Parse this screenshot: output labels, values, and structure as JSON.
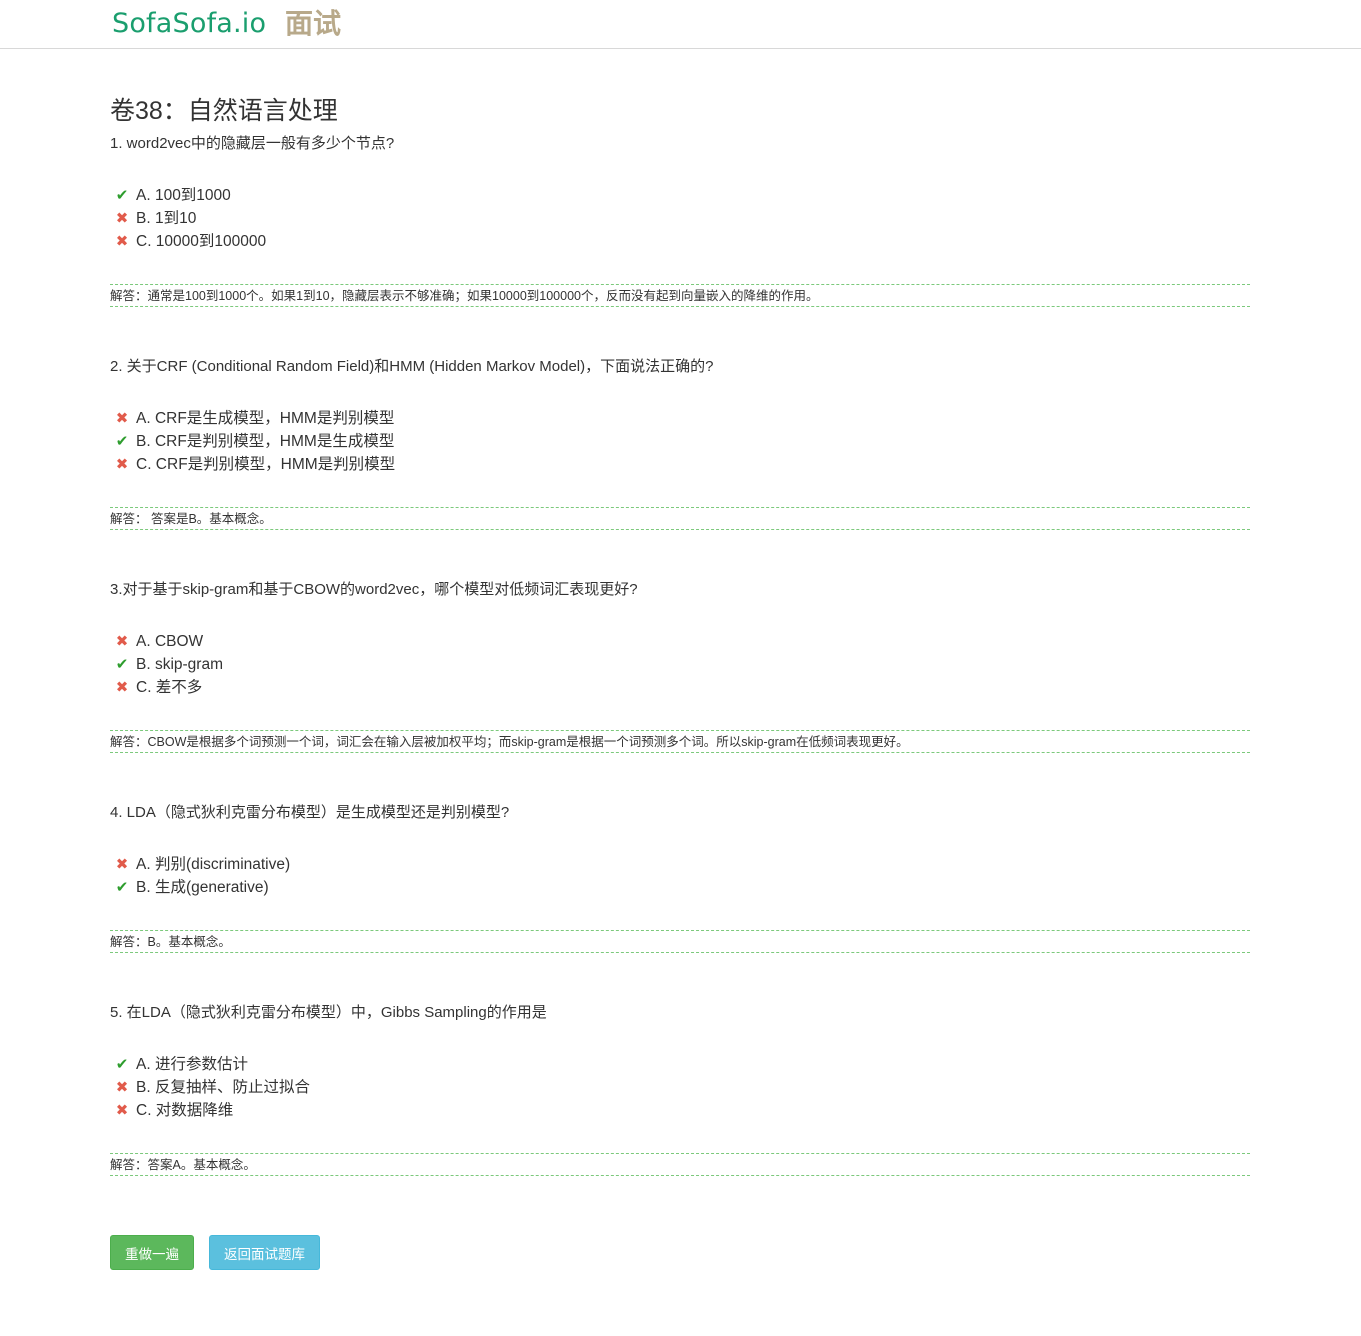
{
  "header": {
    "brand": "SofaSofa.io",
    "section": "面试"
  },
  "exam": {
    "title": "卷38：自然语言处理"
  },
  "questions": [
    {
      "text": "1. word2vec中的隐藏层一般有多少个节点?",
      "options": [
        {
          "label": "A. 100到1000",
          "status": "correct"
        },
        {
          "label": "B. 1到10",
          "status": "wrong"
        },
        {
          "label": "C. 10000到100000",
          "status": "wrong"
        }
      ],
      "answer": "解答：通常是100到1000个。如果1到10，隐藏层表示不够准确；如果10000到100000个，反而没有起到向量嵌入的降维的作用。"
    },
    {
      "text": "2. 关于CRF (Conditional Random Field)和HMM (Hidden Markov Model)，下面说法正确的?",
      "options": [
        {
          "label": "A. CRF是生成模型，HMM是判别模型",
          "status": "wrong"
        },
        {
          "label": "B. CRF是判别模型，HMM是生成模型",
          "status": "correct"
        },
        {
          "label": "C. CRF是判别模型，HMM是判别模型",
          "status": "wrong"
        }
      ],
      "answer": "解答： 答案是B。基本概念。"
    },
    {
      "text": "3.对于基于skip-gram和基于CBOW的word2vec，哪个模型对低频词汇表现更好?",
      "options": [
        {
          "label": "A. CBOW",
          "status": "wrong"
        },
        {
          "label": "B. skip-gram",
          "status": "correct"
        },
        {
          "label": "C. 差不多",
          "status": "wrong"
        }
      ],
      "answer": "解答：CBOW是根据多个词预测一个词，词汇会在输入层被加权平均；而skip-gram是根据一个词预测多个词。所以skip-gram在低频词表现更好。"
    },
    {
      "text": "4. LDA（隐式狄利克雷分布模型）是生成模型还是判别模型?",
      "options": [
        {
          "label": "A. 判别(discriminative)",
          "status": "wrong"
        },
        {
          "label": "B. 生成(generative)",
          "status": "correct"
        }
      ],
      "answer": "解答：B。基本概念。"
    },
    {
      "text": "5. 在LDA（隐式狄利克雷分布模型）中，Gibbs Sampling的作用是",
      "options": [
        {
          "label": "A. 进行参数估计",
          "status": "correct"
        },
        {
          "label": "B. 反复抽样、防止过拟合",
          "status": "wrong"
        },
        {
          "label": "C. 对数据降维",
          "status": "wrong"
        }
      ],
      "answer": "解答：答案A。基本概念。"
    }
  ],
  "buttons": {
    "redo": "重做一遍",
    "back": "返回面试题库"
  },
  "icons": {
    "correct": "check-icon",
    "wrong": "cross-icon"
  },
  "colors": {
    "brand": "#1a9e6e",
    "section": "#b8a98a",
    "correct": "#2e9d2e",
    "wrong": "#e15b4b",
    "answer_border": "#7cc97c",
    "redo_button": "#5cb85c",
    "back_button": "#5bc0de"
  }
}
